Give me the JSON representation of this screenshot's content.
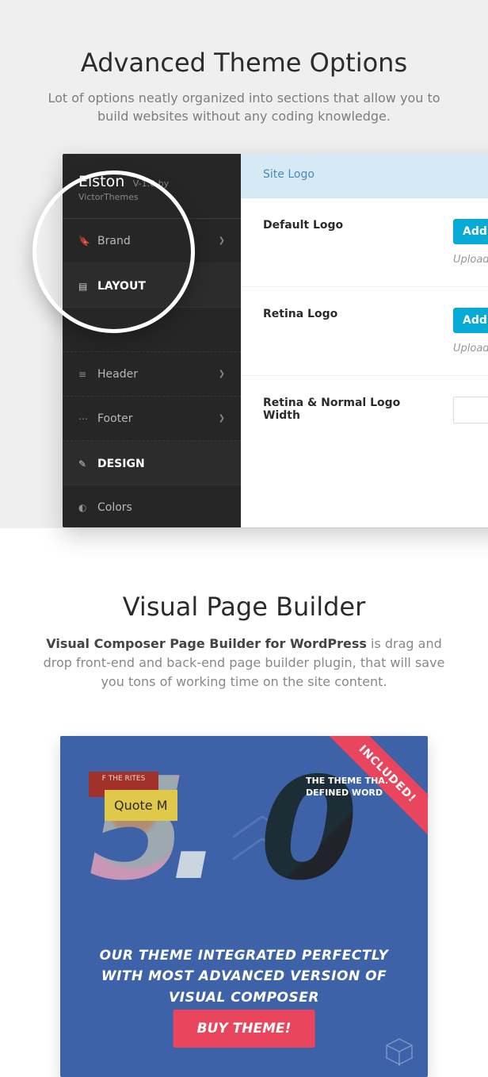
{
  "section1": {
    "title": "Advanced Theme Options",
    "subtitle": "Lot of options neatly organized into sections that allow you to build websites without any coding knowledge."
  },
  "panel": {
    "logo": {
      "name": "Elston",
      "version": "V-1.0 by",
      "author": "VictorThemes"
    },
    "sidebar": [
      {
        "icon": "bookmark-icon",
        "glyph": "🔖",
        "label": "Brand",
        "caret": true,
        "kind": "item"
      },
      {
        "icon": "page-icon",
        "glyph": "▤",
        "label": "LAYOUT",
        "caret": false,
        "kind": "section"
      },
      {
        "icon": "menu-icon",
        "glyph": "≡",
        "label": "Header",
        "caret": true,
        "kind": "dot"
      },
      {
        "icon": "dots-icon",
        "glyph": "⋯",
        "label": "Footer",
        "caret": true,
        "kind": "dot"
      },
      {
        "icon": "wand-icon",
        "glyph": "✎",
        "label": "DESIGN",
        "caret": false,
        "kind": "section"
      },
      {
        "icon": "droplet-icon",
        "glyph": "◐",
        "label": "Colors",
        "caret": false,
        "kind": "item"
      }
    ],
    "tab": "Site Logo",
    "fields": {
      "default_logo": {
        "label": "Default Logo",
        "button": "Add",
        "hint": "Upload"
      },
      "retina_logo": {
        "label": "Retina Logo",
        "button": "Add",
        "hint": "Upload"
      },
      "width": {
        "label": "Retina & Normal Logo Width",
        "value": ""
      }
    }
  },
  "section2": {
    "title": "Visual Page Builder",
    "leadBold": "Visual Composer Page Builder for WordPress",
    "leadRest": " is drag and drop front-end and back-end page builder plugin, that will save you tons of working time on the site content."
  },
  "card": {
    "ribbon": "INCLUDED!",
    "tag": "Quote M",
    "strip": "F THE RITES",
    "inner0": "THE THEME THA. DEFINED WORD",
    "tagline": "OUR THEME INTEGRATED PERFECTLY WITH MOST ADVANCED VERSION OF VISUAL COMPOSER",
    "buy": "BUY THEME!"
  }
}
